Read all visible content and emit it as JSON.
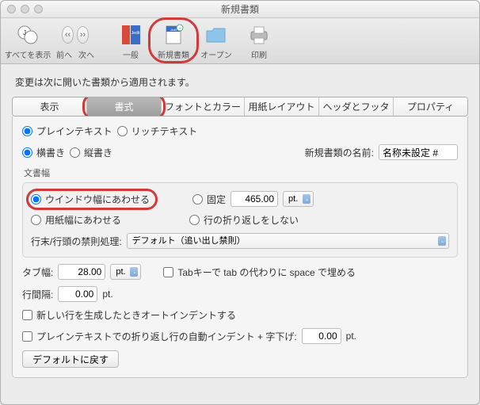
{
  "window": {
    "title": "新規書類"
  },
  "toolbar": {
    "show_all": "すべてを表示",
    "back": "前へ",
    "forward": "次へ",
    "general": "一般",
    "new_doc": "新規書類",
    "open": "オープン",
    "print": "印刷"
  },
  "note": "変更は次に開いた書類から適用されます。",
  "tabs": {
    "display": "表示",
    "format": "書式",
    "fonts_colors": "フォントとカラー",
    "page_layout": "用紙レイアウト",
    "header_footer": "ヘッダとフッタ",
    "properties": "プロパティ"
  },
  "format": {
    "plain_text": "プレインテキスト",
    "rich_text": "リッチテキスト",
    "horizontal": "横書き",
    "vertical": "縦書き",
    "new_doc_name_label": "新規書類の名前:",
    "new_doc_name_value": "名称未設定 #",
    "doc_width_label": "文書幅",
    "fit_window": "ウインドウ幅にあわせる",
    "fit_paper": "用紙幅にあわせる",
    "fixed": "固定",
    "fixed_value": "465.00",
    "fixed_unit": "pt.",
    "no_wrap": "行の折り返しをしない",
    "line_break_label": "行末/行頭の禁則処理:",
    "line_break_value": "デフォルト（追い出し禁則）",
    "tab_width_label": "タブ幅:",
    "tab_width_value": "28.00",
    "tab_width_unit": "pt.",
    "tab_to_space": "Tabキーで tab の代わりに space で埋める",
    "line_spacing_label": "行間隔:",
    "line_spacing_value": "0.00",
    "line_spacing_unit": "pt.",
    "auto_indent": "新しい行を生成したときオートインデントする",
    "wrap_indent_label": "プレインテキストでの折り返し行の自動インデント + 字下げ:",
    "wrap_indent_value": "0.00",
    "wrap_indent_unit": "pt.",
    "reset_defaults": "デフォルトに戻す"
  }
}
